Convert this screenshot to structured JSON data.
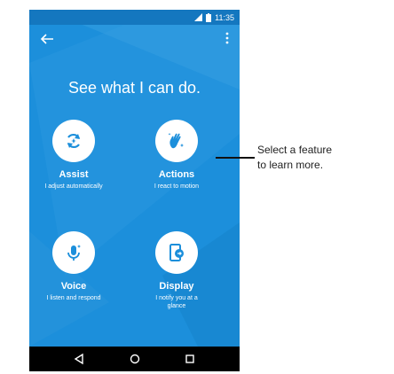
{
  "status_bar": {
    "time": "11:35"
  },
  "headline": "See what I can do.",
  "features": {
    "assist": {
      "name": "Assist",
      "description": "I adjust automatically"
    },
    "actions": {
      "name": "Actions",
      "description": "I react to motion"
    },
    "voice": {
      "name": "Voice",
      "description": "I listen and respond"
    },
    "display": {
      "name": "Display",
      "description": "I notify you at a glance"
    }
  },
  "callout": {
    "line1": "Select a feature",
    "line2": "to learn more."
  },
  "colors": {
    "screen_bg": "#1c8fdb",
    "status_bar_bg": "#1477bf",
    "icon_blue": "#1c8fdb",
    "nav_bar_bg": "#000000"
  },
  "icons": {
    "back": "arrow-left-icon",
    "menu": "overflow-menu-icon",
    "assist": "refresh-sparkle-icon",
    "actions": "wave-hand-icon",
    "voice": "microphone-icon",
    "display": "display-notify-icon"
  }
}
